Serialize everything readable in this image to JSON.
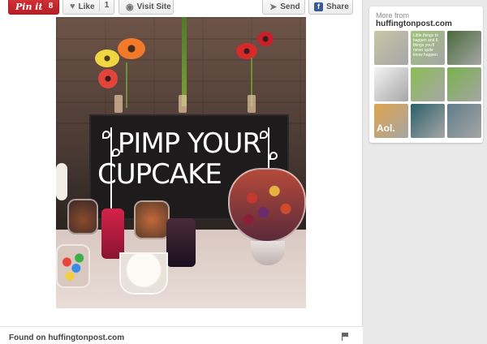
{
  "toolbar": {
    "pinit_label": "Pin it",
    "pinit_count": "8",
    "like_label": "Like",
    "like_count": "1",
    "visit_label": "Visit Site",
    "send_label": "Send",
    "share_label": "Share"
  },
  "photo": {
    "sign_line1": "PIMP YOUR",
    "sign_line2": "CUPCAKE"
  },
  "footer": {
    "found_on": "Found on huffingtonpost.com"
  },
  "sidebar": {
    "more_from": "More from",
    "site": "huffingtonpost.com",
    "thumbnails": [
      {
        "name": "thumb-1",
        "color": "#c9c7a6"
      },
      {
        "name": "thumb-2",
        "color": "#9fc37a",
        "text": "Little things to happen and 6 things you'll never quite know happen"
      },
      {
        "name": "thumb-3",
        "color": "#4a6a3a"
      },
      {
        "name": "thumb-4",
        "color": "#f4f4f4"
      },
      {
        "name": "thumb-5",
        "color": "#8bbd55"
      },
      {
        "name": "thumb-6",
        "color": "#78b24a"
      },
      {
        "name": "thumb-7",
        "color": "#e0a34a",
        "text": "Aol."
      },
      {
        "name": "thumb-8",
        "color": "#2b5f6a"
      },
      {
        "name": "thumb-9",
        "color": "#5f7d8a"
      }
    ]
  },
  "colors": {
    "pinit_red": "#cb2027",
    "facebook_blue": "#3b5998",
    "page_bg": "#e9e9e9"
  }
}
